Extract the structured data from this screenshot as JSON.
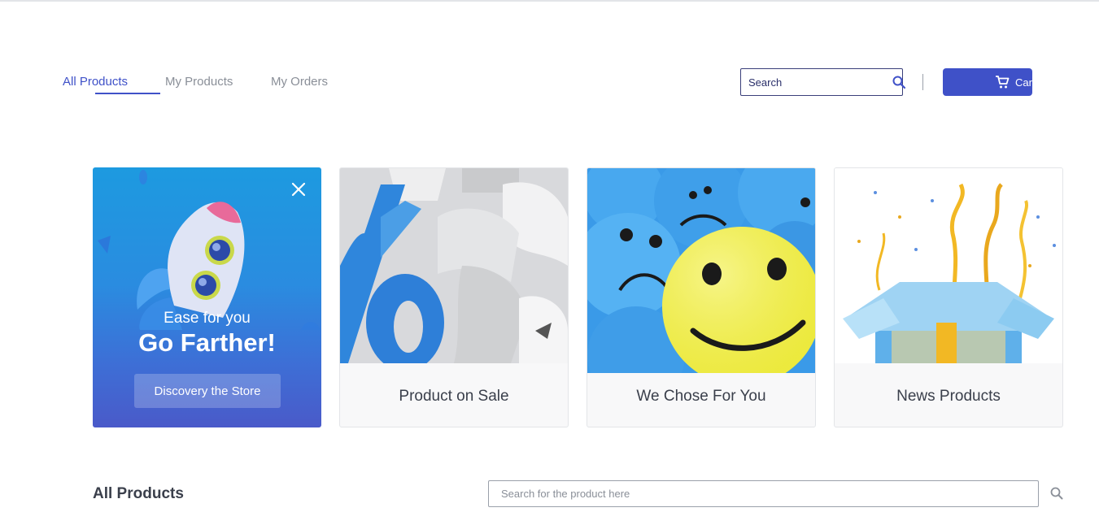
{
  "nav": {
    "tabs": [
      {
        "label": "All Products",
        "active": true
      },
      {
        "label": "My Products",
        "active": false
      },
      {
        "label": "My Orders",
        "active": false
      }
    ]
  },
  "header": {
    "search_placeholder": "Search",
    "cart_label": "Cart",
    "accent_color": "#3f51c8"
  },
  "promo": {
    "tagline": "Ease for you",
    "title": "Go Farther!",
    "button_label": "Discovery the Store"
  },
  "categories": [
    {
      "label": "Product on Sale",
      "image": "percent-dollar-symbols"
    },
    {
      "label": "We Chose For You",
      "image": "smiley-balls"
    },
    {
      "label": "News Products",
      "image": "gift-box-confetti"
    }
  ],
  "products_section": {
    "title": "All Products",
    "search_placeholder": "Search for the product here"
  }
}
